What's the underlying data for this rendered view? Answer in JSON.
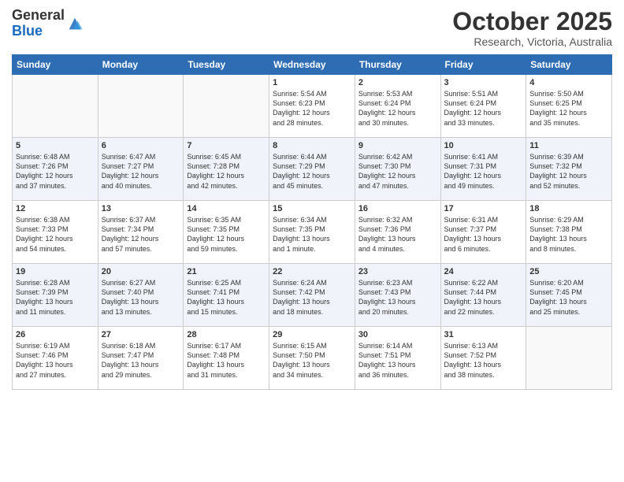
{
  "logo": {
    "general": "General",
    "blue": "Blue"
  },
  "header": {
    "month": "October 2025",
    "location": "Research, Victoria, Australia"
  },
  "weekdays": [
    "Sunday",
    "Monday",
    "Tuesday",
    "Wednesday",
    "Thursday",
    "Friday",
    "Saturday"
  ],
  "weeks": [
    [
      {
        "day": "",
        "info": ""
      },
      {
        "day": "",
        "info": ""
      },
      {
        "day": "",
        "info": ""
      },
      {
        "day": "1",
        "info": "Sunrise: 5:54 AM\nSunset: 6:23 PM\nDaylight: 12 hours\nand 28 minutes."
      },
      {
        "day": "2",
        "info": "Sunrise: 5:53 AM\nSunset: 6:24 PM\nDaylight: 12 hours\nand 30 minutes."
      },
      {
        "day": "3",
        "info": "Sunrise: 5:51 AM\nSunset: 6:24 PM\nDaylight: 12 hours\nand 33 minutes."
      },
      {
        "day": "4",
        "info": "Sunrise: 5:50 AM\nSunset: 6:25 PM\nDaylight: 12 hours\nand 35 minutes."
      }
    ],
    [
      {
        "day": "5",
        "info": "Sunrise: 6:48 AM\nSunset: 7:26 PM\nDaylight: 12 hours\nand 37 minutes."
      },
      {
        "day": "6",
        "info": "Sunrise: 6:47 AM\nSunset: 7:27 PM\nDaylight: 12 hours\nand 40 minutes."
      },
      {
        "day": "7",
        "info": "Sunrise: 6:45 AM\nSunset: 7:28 PM\nDaylight: 12 hours\nand 42 minutes."
      },
      {
        "day": "8",
        "info": "Sunrise: 6:44 AM\nSunset: 7:29 PM\nDaylight: 12 hours\nand 45 minutes."
      },
      {
        "day": "9",
        "info": "Sunrise: 6:42 AM\nSunset: 7:30 PM\nDaylight: 12 hours\nand 47 minutes."
      },
      {
        "day": "10",
        "info": "Sunrise: 6:41 AM\nSunset: 7:31 PM\nDaylight: 12 hours\nand 49 minutes."
      },
      {
        "day": "11",
        "info": "Sunrise: 6:39 AM\nSunset: 7:32 PM\nDaylight: 12 hours\nand 52 minutes."
      }
    ],
    [
      {
        "day": "12",
        "info": "Sunrise: 6:38 AM\nSunset: 7:33 PM\nDaylight: 12 hours\nand 54 minutes."
      },
      {
        "day": "13",
        "info": "Sunrise: 6:37 AM\nSunset: 7:34 PM\nDaylight: 12 hours\nand 57 minutes."
      },
      {
        "day": "14",
        "info": "Sunrise: 6:35 AM\nSunset: 7:35 PM\nDaylight: 12 hours\nand 59 minutes."
      },
      {
        "day": "15",
        "info": "Sunrise: 6:34 AM\nSunset: 7:35 PM\nDaylight: 13 hours\nand 1 minute."
      },
      {
        "day": "16",
        "info": "Sunrise: 6:32 AM\nSunset: 7:36 PM\nDaylight: 13 hours\nand 4 minutes."
      },
      {
        "day": "17",
        "info": "Sunrise: 6:31 AM\nSunset: 7:37 PM\nDaylight: 13 hours\nand 6 minutes."
      },
      {
        "day": "18",
        "info": "Sunrise: 6:29 AM\nSunset: 7:38 PM\nDaylight: 13 hours\nand 8 minutes."
      }
    ],
    [
      {
        "day": "19",
        "info": "Sunrise: 6:28 AM\nSunset: 7:39 PM\nDaylight: 13 hours\nand 11 minutes."
      },
      {
        "day": "20",
        "info": "Sunrise: 6:27 AM\nSunset: 7:40 PM\nDaylight: 13 hours\nand 13 minutes."
      },
      {
        "day": "21",
        "info": "Sunrise: 6:25 AM\nSunset: 7:41 PM\nDaylight: 13 hours\nand 15 minutes."
      },
      {
        "day": "22",
        "info": "Sunrise: 6:24 AM\nSunset: 7:42 PM\nDaylight: 13 hours\nand 18 minutes."
      },
      {
        "day": "23",
        "info": "Sunrise: 6:23 AM\nSunset: 7:43 PM\nDaylight: 13 hours\nand 20 minutes."
      },
      {
        "day": "24",
        "info": "Sunrise: 6:22 AM\nSunset: 7:44 PM\nDaylight: 13 hours\nand 22 minutes."
      },
      {
        "day": "25",
        "info": "Sunrise: 6:20 AM\nSunset: 7:45 PM\nDaylight: 13 hours\nand 25 minutes."
      }
    ],
    [
      {
        "day": "26",
        "info": "Sunrise: 6:19 AM\nSunset: 7:46 PM\nDaylight: 13 hours\nand 27 minutes."
      },
      {
        "day": "27",
        "info": "Sunrise: 6:18 AM\nSunset: 7:47 PM\nDaylight: 13 hours\nand 29 minutes."
      },
      {
        "day": "28",
        "info": "Sunrise: 6:17 AM\nSunset: 7:48 PM\nDaylight: 13 hours\nand 31 minutes."
      },
      {
        "day": "29",
        "info": "Sunrise: 6:15 AM\nSunset: 7:50 PM\nDaylight: 13 hours\nand 34 minutes."
      },
      {
        "day": "30",
        "info": "Sunrise: 6:14 AM\nSunset: 7:51 PM\nDaylight: 13 hours\nand 36 minutes."
      },
      {
        "day": "31",
        "info": "Sunrise: 6:13 AM\nSunset: 7:52 PM\nDaylight: 13 hours\nand 38 minutes."
      },
      {
        "day": "",
        "info": ""
      }
    ]
  ]
}
